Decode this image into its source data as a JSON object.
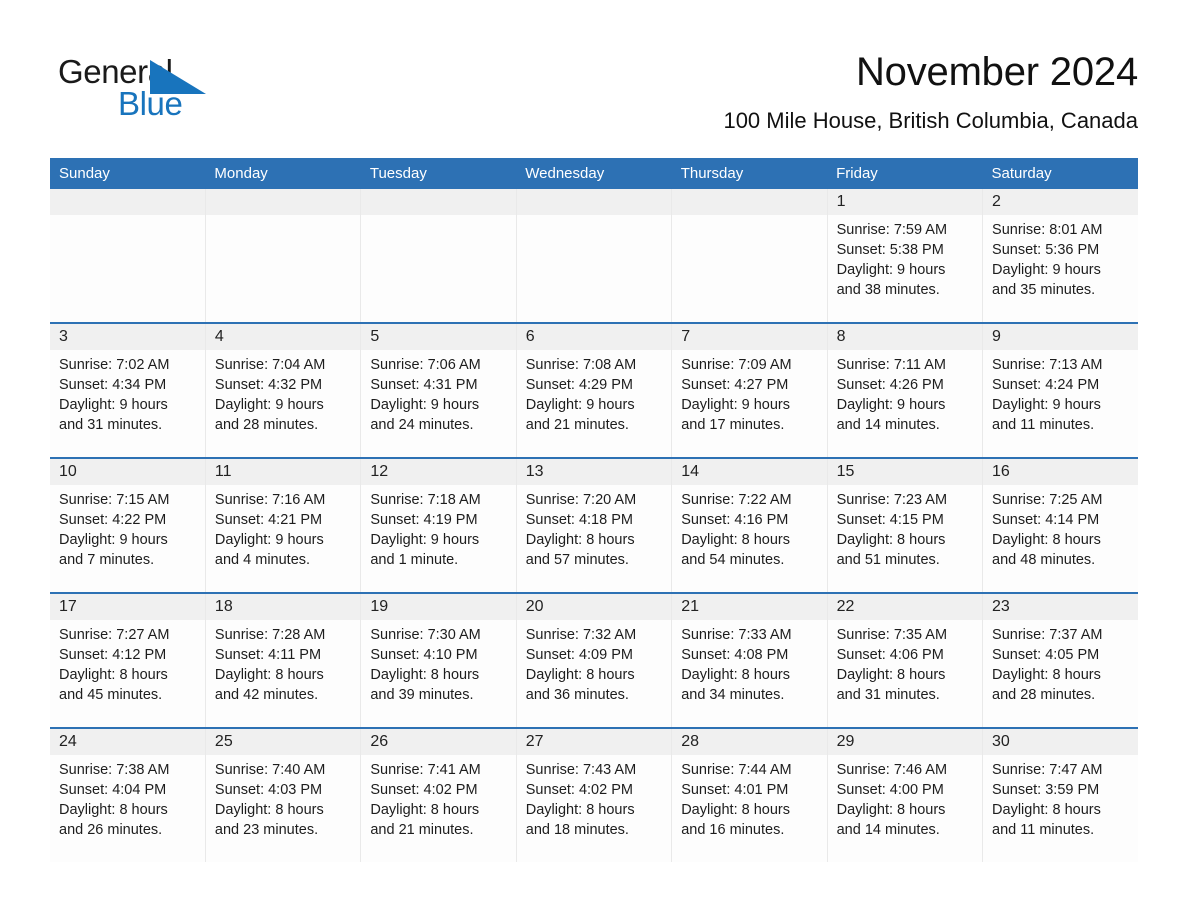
{
  "brand": {
    "name_part1": "General",
    "name_part2": "Blue",
    "triangle_color": "#1874bd",
    "text_color": "#1a1a1a"
  },
  "header": {
    "title": "November 2024",
    "location": "100 Mile House, British Columbia, Canada",
    "header_bg": "#2d71b4",
    "header_text_color": "#ffffff",
    "row_separator_color": "#2d71b4",
    "daynum_band_color": "#f0f0f0"
  },
  "weekday_headers": [
    "Sunday",
    "Monday",
    "Tuesday",
    "Wednesday",
    "Thursday",
    "Friday",
    "Saturday"
  ],
  "weeks": [
    [
      {
        "day": "",
        "lines": []
      },
      {
        "day": "",
        "lines": []
      },
      {
        "day": "",
        "lines": []
      },
      {
        "day": "",
        "lines": []
      },
      {
        "day": "",
        "lines": []
      },
      {
        "day": "1",
        "lines": [
          "Sunrise: 7:59 AM",
          "Sunset: 5:38 PM",
          "Daylight: 9 hours",
          "and 38 minutes."
        ]
      },
      {
        "day": "2",
        "lines": [
          "Sunrise: 8:01 AM",
          "Sunset: 5:36 PM",
          "Daylight: 9 hours",
          "and 35 minutes."
        ]
      }
    ],
    [
      {
        "day": "3",
        "lines": [
          "Sunrise: 7:02 AM",
          "Sunset: 4:34 PM",
          "Daylight: 9 hours",
          "and 31 minutes."
        ]
      },
      {
        "day": "4",
        "lines": [
          "Sunrise: 7:04 AM",
          "Sunset: 4:32 PM",
          "Daylight: 9 hours",
          "and 28 minutes."
        ]
      },
      {
        "day": "5",
        "lines": [
          "Sunrise: 7:06 AM",
          "Sunset: 4:31 PM",
          "Daylight: 9 hours",
          "and 24 minutes."
        ]
      },
      {
        "day": "6",
        "lines": [
          "Sunrise: 7:08 AM",
          "Sunset: 4:29 PM",
          "Daylight: 9 hours",
          "and 21 minutes."
        ]
      },
      {
        "day": "7",
        "lines": [
          "Sunrise: 7:09 AM",
          "Sunset: 4:27 PM",
          "Daylight: 9 hours",
          "and 17 minutes."
        ]
      },
      {
        "day": "8",
        "lines": [
          "Sunrise: 7:11 AM",
          "Sunset: 4:26 PM",
          "Daylight: 9 hours",
          "and 14 minutes."
        ]
      },
      {
        "day": "9",
        "lines": [
          "Sunrise: 7:13 AM",
          "Sunset: 4:24 PM",
          "Daylight: 9 hours",
          "and 11 minutes."
        ]
      }
    ],
    [
      {
        "day": "10",
        "lines": [
          "Sunrise: 7:15 AM",
          "Sunset: 4:22 PM",
          "Daylight: 9 hours",
          "and 7 minutes."
        ]
      },
      {
        "day": "11",
        "lines": [
          "Sunrise: 7:16 AM",
          "Sunset: 4:21 PM",
          "Daylight: 9 hours",
          "and 4 minutes."
        ]
      },
      {
        "day": "12",
        "lines": [
          "Sunrise: 7:18 AM",
          "Sunset: 4:19 PM",
          "Daylight: 9 hours",
          "and 1 minute."
        ]
      },
      {
        "day": "13",
        "lines": [
          "Sunrise: 7:20 AM",
          "Sunset: 4:18 PM",
          "Daylight: 8 hours",
          "and 57 minutes."
        ]
      },
      {
        "day": "14",
        "lines": [
          "Sunrise: 7:22 AM",
          "Sunset: 4:16 PM",
          "Daylight: 8 hours",
          "and 54 minutes."
        ]
      },
      {
        "day": "15",
        "lines": [
          "Sunrise: 7:23 AM",
          "Sunset: 4:15 PM",
          "Daylight: 8 hours",
          "and 51 minutes."
        ]
      },
      {
        "day": "16",
        "lines": [
          "Sunrise: 7:25 AM",
          "Sunset: 4:14 PM",
          "Daylight: 8 hours",
          "and 48 minutes."
        ]
      }
    ],
    [
      {
        "day": "17",
        "lines": [
          "Sunrise: 7:27 AM",
          "Sunset: 4:12 PM",
          "Daylight: 8 hours",
          "and 45 minutes."
        ]
      },
      {
        "day": "18",
        "lines": [
          "Sunrise: 7:28 AM",
          "Sunset: 4:11 PM",
          "Daylight: 8 hours",
          "and 42 minutes."
        ]
      },
      {
        "day": "19",
        "lines": [
          "Sunrise: 7:30 AM",
          "Sunset: 4:10 PM",
          "Daylight: 8 hours",
          "and 39 minutes."
        ]
      },
      {
        "day": "20",
        "lines": [
          "Sunrise: 7:32 AM",
          "Sunset: 4:09 PM",
          "Daylight: 8 hours",
          "and 36 minutes."
        ]
      },
      {
        "day": "21",
        "lines": [
          "Sunrise: 7:33 AM",
          "Sunset: 4:08 PM",
          "Daylight: 8 hours",
          "and 34 minutes."
        ]
      },
      {
        "day": "22",
        "lines": [
          "Sunrise: 7:35 AM",
          "Sunset: 4:06 PM",
          "Daylight: 8 hours",
          "and 31 minutes."
        ]
      },
      {
        "day": "23",
        "lines": [
          "Sunrise: 7:37 AM",
          "Sunset: 4:05 PM",
          "Daylight: 8 hours",
          "and 28 minutes."
        ]
      }
    ],
    [
      {
        "day": "24",
        "lines": [
          "Sunrise: 7:38 AM",
          "Sunset: 4:04 PM",
          "Daylight: 8 hours",
          "and 26 minutes."
        ]
      },
      {
        "day": "25",
        "lines": [
          "Sunrise: 7:40 AM",
          "Sunset: 4:03 PM",
          "Daylight: 8 hours",
          "and 23 minutes."
        ]
      },
      {
        "day": "26",
        "lines": [
          "Sunrise: 7:41 AM",
          "Sunset: 4:02 PM",
          "Daylight: 8 hours",
          "and 21 minutes."
        ]
      },
      {
        "day": "27",
        "lines": [
          "Sunrise: 7:43 AM",
          "Sunset: 4:02 PM",
          "Daylight: 8 hours",
          "and 18 minutes."
        ]
      },
      {
        "day": "28",
        "lines": [
          "Sunrise: 7:44 AM",
          "Sunset: 4:01 PM",
          "Daylight: 8 hours",
          "and 16 minutes."
        ]
      },
      {
        "day": "29",
        "lines": [
          "Sunrise: 7:46 AM",
          "Sunset: 4:00 PM",
          "Daylight: 8 hours",
          "and 14 minutes."
        ]
      },
      {
        "day": "30",
        "lines": [
          "Sunrise: 7:47 AM",
          "Sunset: 3:59 PM",
          "Daylight: 8 hours",
          "and 11 minutes."
        ]
      }
    ]
  ]
}
